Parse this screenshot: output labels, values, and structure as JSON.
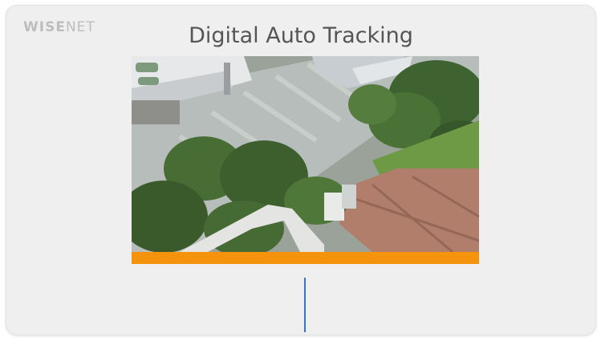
{
  "brand": {
    "bold": "WISE",
    "thin": "NET"
  },
  "slide": {
    "title": "Digital Auto Tracking"
  },
  "video": {
    "progress": 1.0,
    "accent_color": "#f5930c"
  },
  "colors": {
    "cursor": "#2f73e0",
    "background": "#efefef"
  }
}
